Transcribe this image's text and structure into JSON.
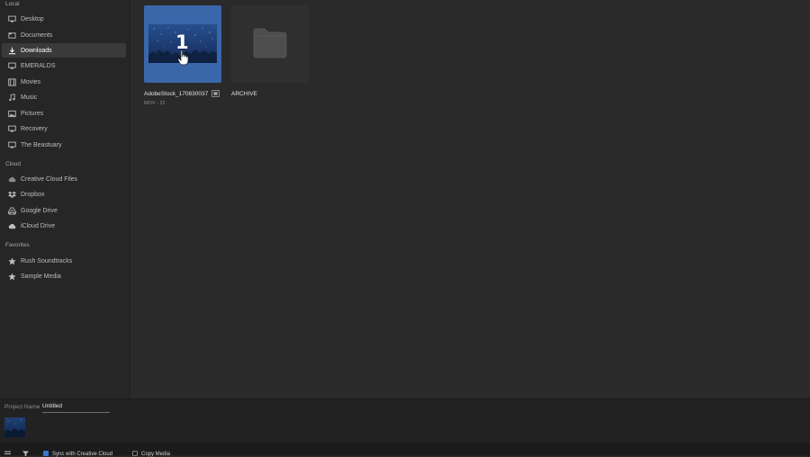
{
  "sidebar": {
    "sections": {
      "local": "Local",
      "cloud": "Cloud",
      "favorites": "Favorites"
    },
    "local_items": [
      {
        "label": "Desktop",
        "icon": "monitor-icon"
      },
      {
        "label": "Documents",
        "icon": "document-icon"
      },
      {
        "label": "Downloads",
        "icon": "download-icon",
        "active": true
      },
      {
        "label": "EMERALDS",
        "icon": "monitor-icon"
      },
      {
        "label": "Movies",
        "icon": "movie-icon"
      },
      {
        "label": "Music",
        "icon": "music-icon"
      },
      {
        "label": "Pictures",
        "icon": "picture-icon"
      },
      {
        "label": "Recovery",
        "icon": "monitor-icon"
      },
      {
        "label": "The Beastuary",
        "icon": "monitor-icon"
      }
    ],
    "cloud_items": [
      {
        "label": "Creative Cloud Files",
        "icon": "creative-cloud-icon"
      },
      {
        "label": "Dropbox",
        "icon": "dropbox-icon"
      },
      {
        "label": "Google Drive",
        "icon": "google-drive-icon"
      },
      {
        "label": "iCloud Drive",
        "icon": "cloud-icon"
      }
    ],
    "favorite_items": [
      {
        "label": "Rush Soundtracks",
        "icon": "star-icon"
      },
      {
        "label": "Sample Media",
        "icon": "star-icon"
      }
    ]
  },
  "files": [
    {
      "name": "AdobeStock_170830037",
      "meta": "MOV - 22",
      "badge": "1",
      "icon": "video-thumbnail",
      "selected": true
    },
    {
      "name": "ARCHIVE",
      "meta": "",
      "icon": "folder-icon"
    }
  ],
  "project": {
    "name_label": "Project Name",
    "name_value": "Untitled"
  },
  "bottom_tools": {
    "sync_label": "Sync with Creative Cloud",
    "copy_label": "Copy Media",
    "sync_checked": true,
    "copy_checked": false
  },
  "colors": {
    "sidebar_bg": "#262626",
    "main_bg": "#2a2a2a",
    "selected_tile": "#3a67aa",
    "accent_check": "#3a76d6"
  }
}
